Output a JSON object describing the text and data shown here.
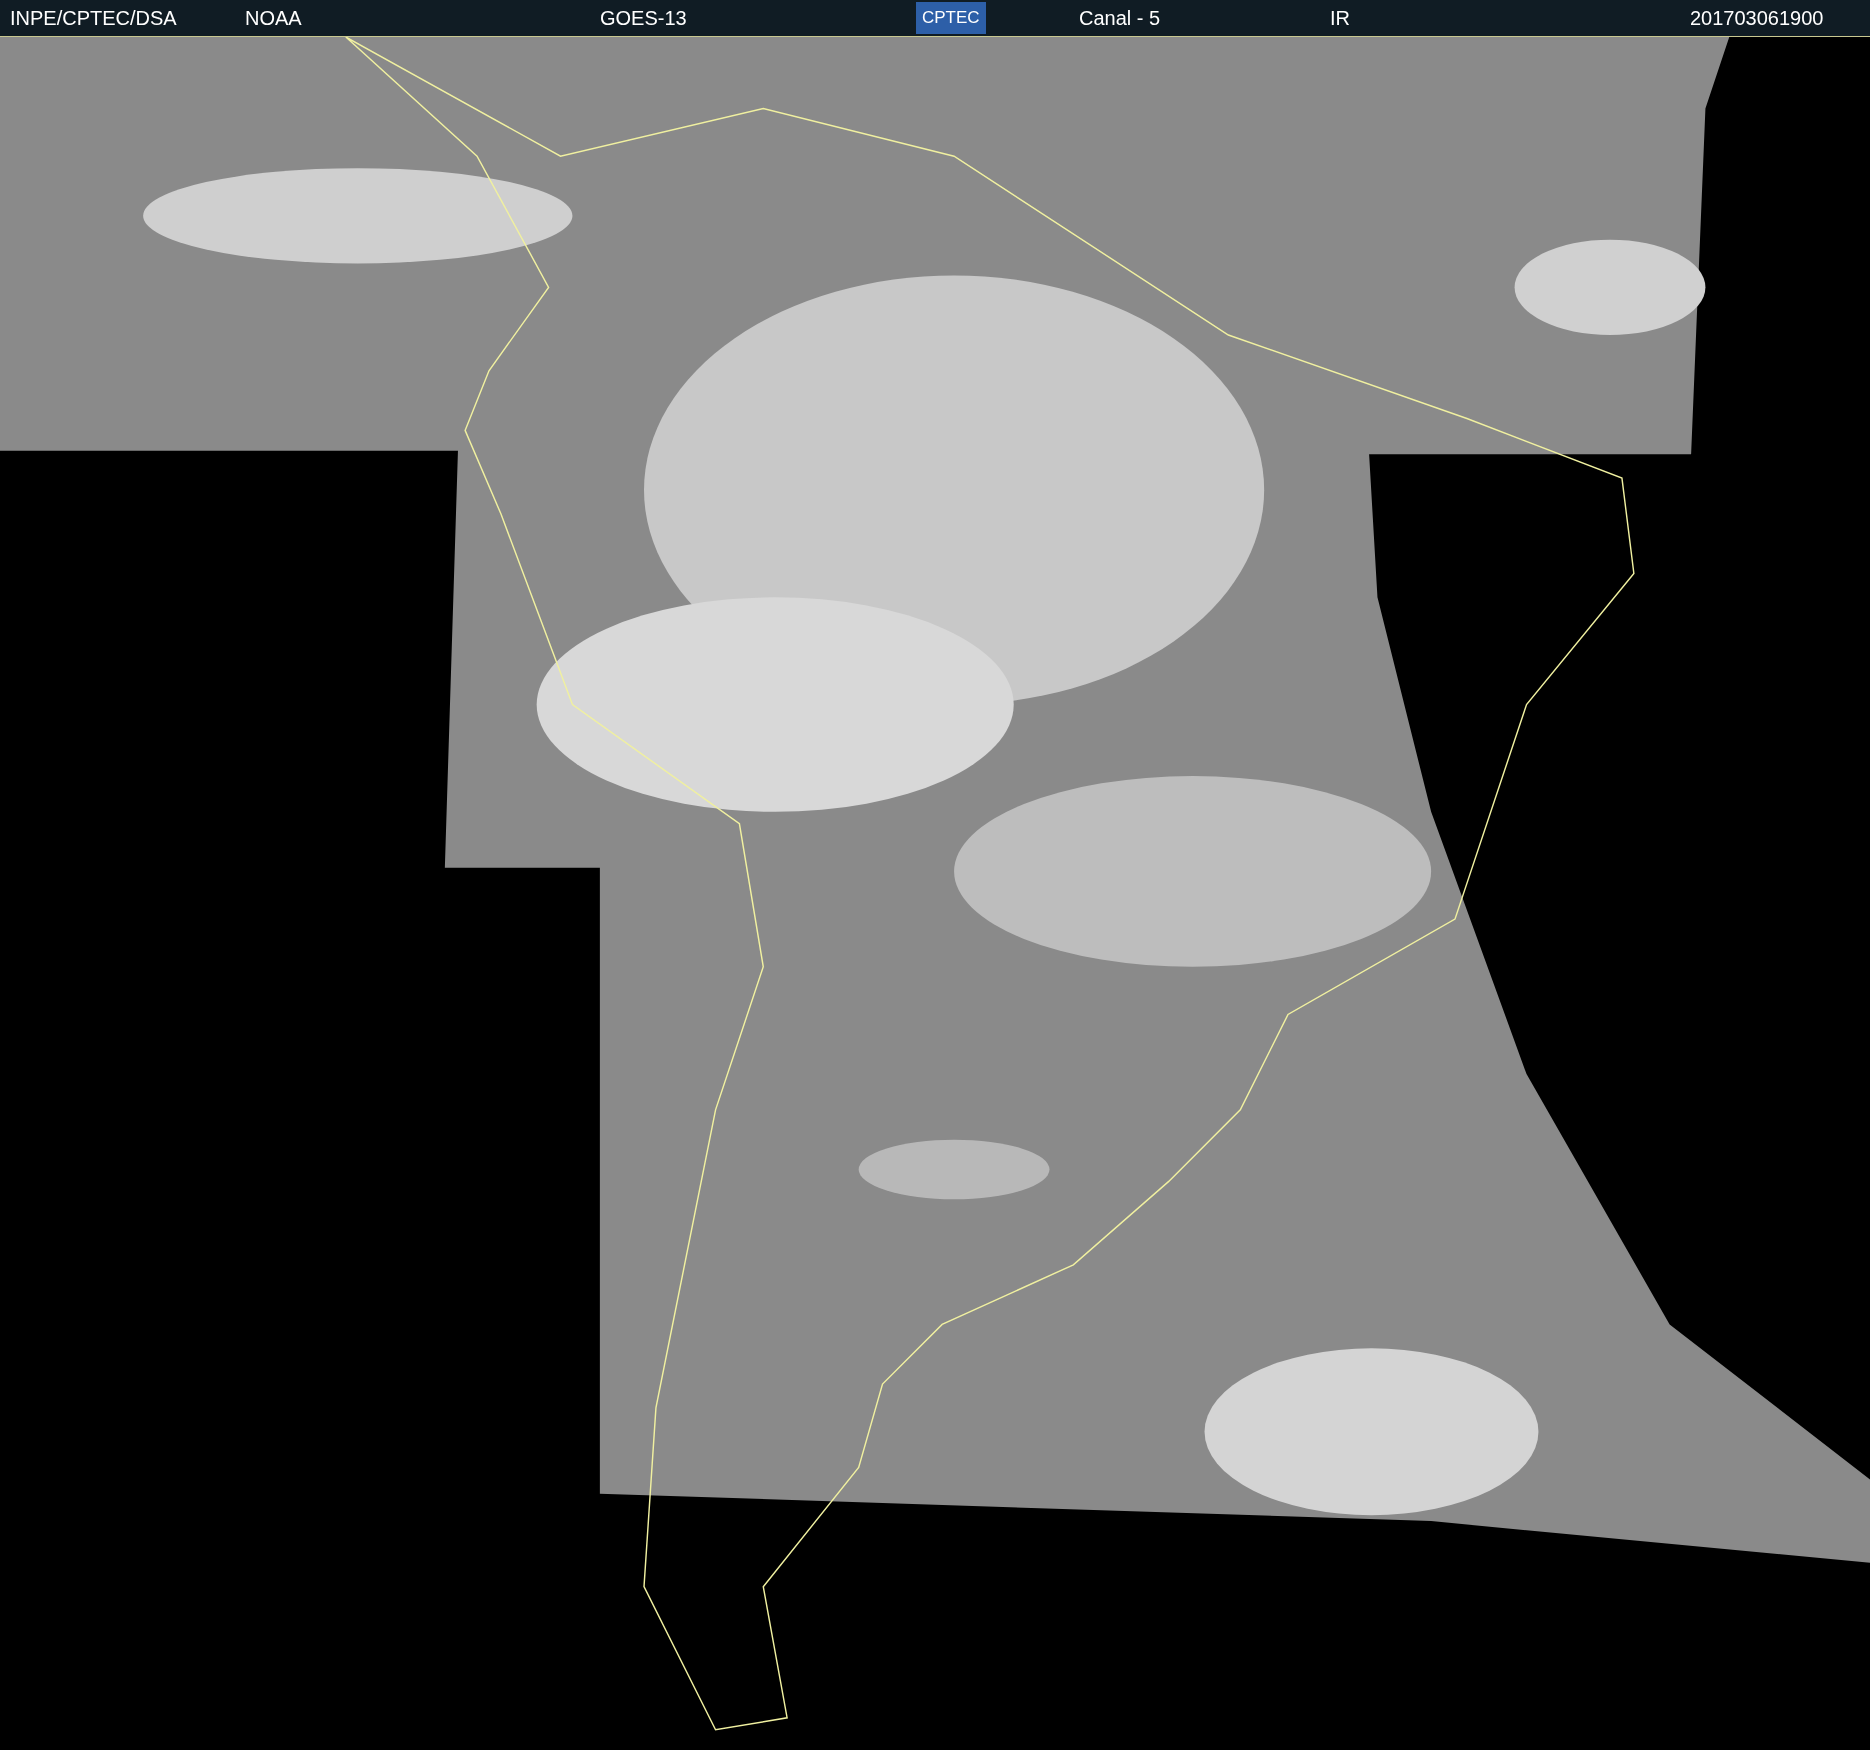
{
  "header": {
    "source": "INPE/CPTEC/DSA",
    "agency": "NOAA",
    "satellite": "GOES-13",
    "logo": "CPTEC",
    "channel": "Canal - 5",
    "band": "IR",
    "timestamp": "201703061900"
  }
}
